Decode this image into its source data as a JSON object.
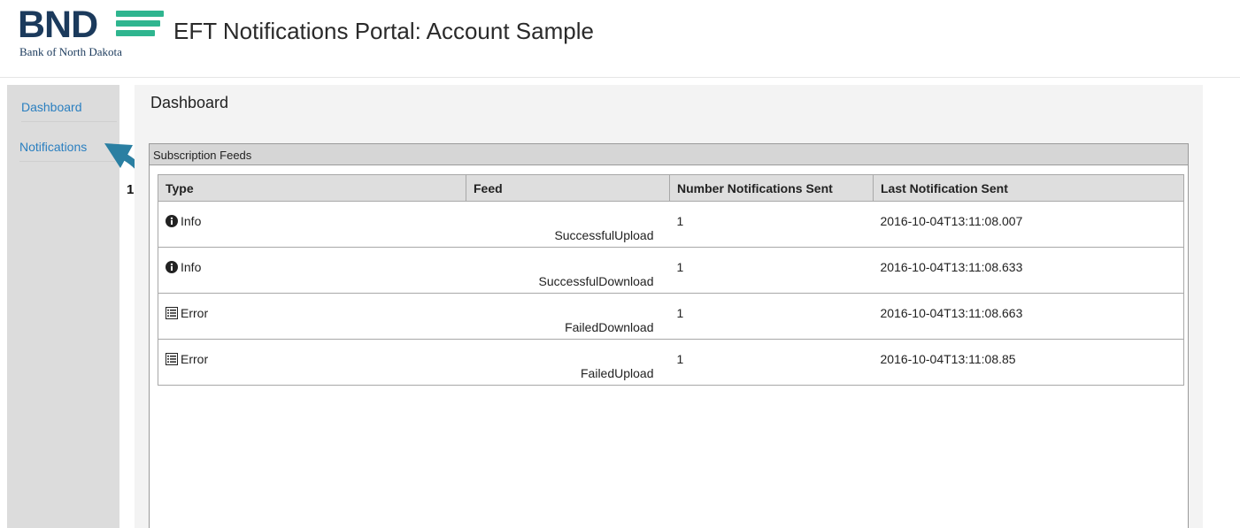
{
  "header": {
    "logo_text": "BND",
    "logo_subtitle": "Bank of North Dakota",
    "title": "EFT Notifications Portal: Account Sample"
  },
  "sidebar": {
    "items": [
      {
        "label": "Dashboard"
      },
      {
        "label": "Notifications"
      }
    ]
  },
  "annotation": {
    "number": "1"
  },
  "main": {
    "title": "Dashboard",
    "panel_title": "Subscription Feeds",
    "columns": [
      "Type",
      "Feed",
      "Number Notifications Sent",
      "Last Notification Sent"
    ],
    "rows": [
      {
        "type": "Info",
        "icon": "info-circle-icon",
        "feed": "SuccessfulUpload",
        "count": "1",
        "last": "2016-10-04T13:11:08.007"
      },
      {
        "type": "Info",
        "icon": "info-circle-icon",
        "feed": "SuccessfulDownload",
        "count": "1",
        "last": "2016-10-04T13:11:08.633"
      },
      {
        "type": "Error",
        "icon": "list-icon",
        "feed": "FailedDownload",
        "count": "1",
        "last": "2016-10-04T13:11:08.663"
      },
      {
        "type": "Error",
        "icon": "list-icon",
        "feed": "FailedUpload",
        "count": "1",
        "last": "2016-10-04T13:11:08.85"
      }
    ]
  },
  "colors": {
    "brand_navy": "#1b3a5c",
    "brand_green": "#2fb58f",
    "link_blue": "#2a7fc0",
    "annotation_teal": "#2a7fa2"
  }
}
